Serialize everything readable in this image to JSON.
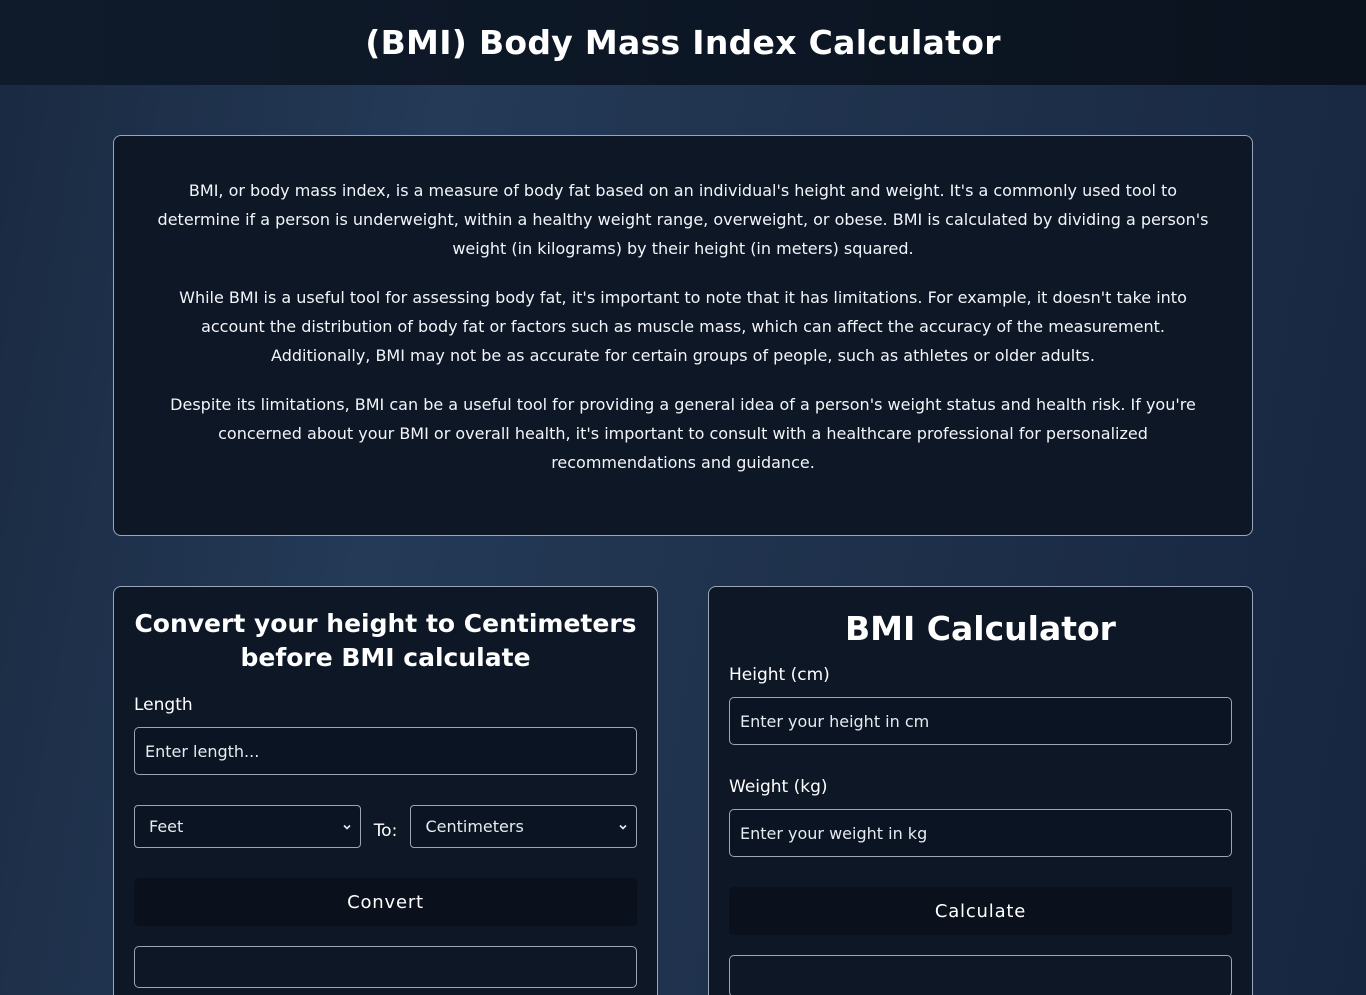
{
  "header": {
    "title": "(BMI) Body Mass Index Calculator"
  },
  "info": {
    "paragraphs": [
      "BMI, or body mass index, is a measure of body fat based on an individual's height and weight. It's a commonly used tool to determine if a person is underweight, within a healthy weight range, overweight, or obese. BMI is calculated by dividing a person's weight (in kilograms) by their height (in meters) squared.",
      "While BMI is a useful tool for assessing body fat, it's important to note that it has limitations. For example, it doesn't take into account the distribution of body fat or factors such as muscle mass, which can affect the accuracy of the measurement. Additionally, BMI may not be as accurate for certain groups of people, such as athletes or older adults.",
      "Despite its limitations, BMI can be a useful tool for providing a general idea of a person's weight status and health risk. If you're concerned about your BMI or overall health, it's important to consult with a healthcare professional for personalized recommendations and guidance."
    ]
  },
  "converter": {
    "title": "Convert your height to Centimeters before BMI calculate",
    "length_label": "Length",
    "length_placeholder": "Enter length...",
    "from_unit": "Feet",
    "to_label": "To:",
    "to_unit": "Centimeters",
    "button_label": "Convert",
    "result": ""
  },
  "calculator": {
    "title": "BMI Calculator",
    "height_label": "Height (cm)",
    "height_placeholder": "Enter your height in cm",
    "weight_label": "Weight (kg)",
    "weight_placeholder": "Enter your weight in kg",
    "button_label": "Calculate",
    "result": ""
  },
  "icons": {
    "dropdown": "chevron-down-icon"
  },
  "colors": {
    "header_bg": "#0c1624",
    "card_bg": "#0e1726",
    "border": "#9aa6b8",
    "page_bg": "#243a57"
  }
}
